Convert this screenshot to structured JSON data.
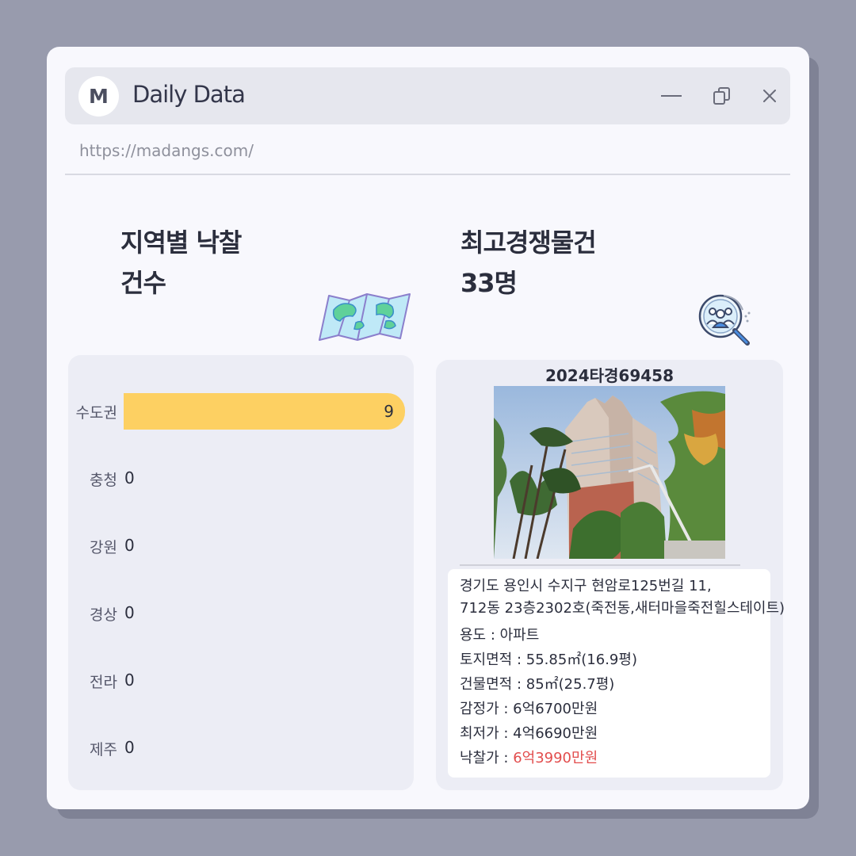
{
  "window": {
    "logo_letter": "M",
    "title": "Daily Data",
    "url": "https://madangs.com/"
  },
  "left": {
    "heading_line1": "지역별 낙찰",
    "heading_line2": "건수",
    "icon": "map-icon",
    "regions": [
      {
        "name": "수도권",
        "count": 9
      },
      {
        "name": "충청",
        "count": 0
      },
      {
        "name": "강원",
        "count": 0
      },
      {
        "name": "경상",
        "count": 0
      },
      {
        "name": "전라",
        "count": 0
      },
      {
        "name": "제주",
        "count": 0
      }
    ],
    "max_count": 9
  },
  "right": {
    "heading_line1": "최고경쟁물건",
    "heading_line2": "33명",
    "icon": "people-search-icon",
    "case_number": "2024타경69458",
    "address_line1": "경기도 용인시 수지구 현암로125번길 11,",
    "address_line2": "712동 23층2302호(죽전동,새터마을죽전힐스테이트)",
    "usage": "용도 : 아파트",
    "land_area": "토지면적 : 55.85㎡(16.9평)",
    "building_area": "건물면적 : 85㎡(25.7평)",
    "appraisal": "감정가 : 6억6700만원",
    "minimum": "최저가 : 4억6690만원",
    "winning_label": "낙찰가 : ",
    "winning_value": "6억3990만원"
  },
  "colors": {
    "bar": "#fdd062",
    "highlight": "#e24d4d",
    "panel": "#ecedf5",
    "background": "#989bad"
  }
}
